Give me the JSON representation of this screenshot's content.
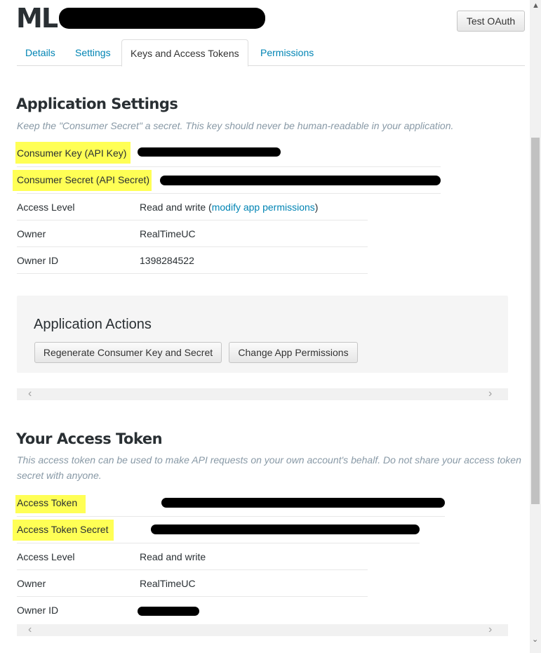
{
  "app": {
    "title": "ML"
  },
  "header": {
    "test_oauth_label": "Test OAuth"
  },
  "tabs": [
    {
      "label": "Details"
    },
    {
      "label": "Settings"
    },
    {
      "label": "Keys and Access Tokens",
      "active": true
    },
    {
      "label": "Permissions"
    }
  ],
  "application_settings": {
    "title": "Application Settings",
    "hint": "Keep the \"Consumer Secret\" a secret. This key should never be human-readable in your application.",
    "rows": [
      {
        "label": "Consumer Key (API Key)",
        "redacted": true
      },
      {
        "label": "Consumer Secret (API Secret)",
        "redacted": true
      },
      {
        "label": "Access Level",
        "value_prefix": "Read and write (",
        "link": "modify app permissions",
        "value_suffix": ")"
      },
      {
        "label": "Owner",
        "value": "RealTimeUC"
      },
      {
        "label": "Owner ID",
        "value": "1398284522"
      }
    ]
  },
  "application_actions": {
    "title": "Application Actions",
    "regenerate_label": "Regenerate Consumer Key and Secret",
    "change_permissions_label": "Change App Permissions"
  },
  "access_token": {
    "title": "Your Access Token",
    "hint": "This access token can be used to make API requests on your own account's behalf. Do not share your access token secret with anyone.",
    "rows": [
      {
        "label": "Access Token",
        "redacted": true
      },
      {
        "label": "Access Token Secret",
        "redacted": true
      },
      {
        "label": "Access Level",
        "value": "Read and write"
      },
      {
        "label": "Owner",
        "value": "RealTimeUC"
      },
      {
        "label": "Owner ID",
        "redacted": true
      }
    ]
  },
  "colors": {
    "link": "#0084b4",
    "highlight": "#ffff55",
    "text": "#292f33",
    "hint": "#8899a6"
  },
  "icons": {
    "scroll_left": "chevron-left-icon",
    "scroll_right": "chevron-right-icon",
    "scroll_up": "chevron-up-icon",
    "scroll_down": "chevron-down-icon"
  }
}
